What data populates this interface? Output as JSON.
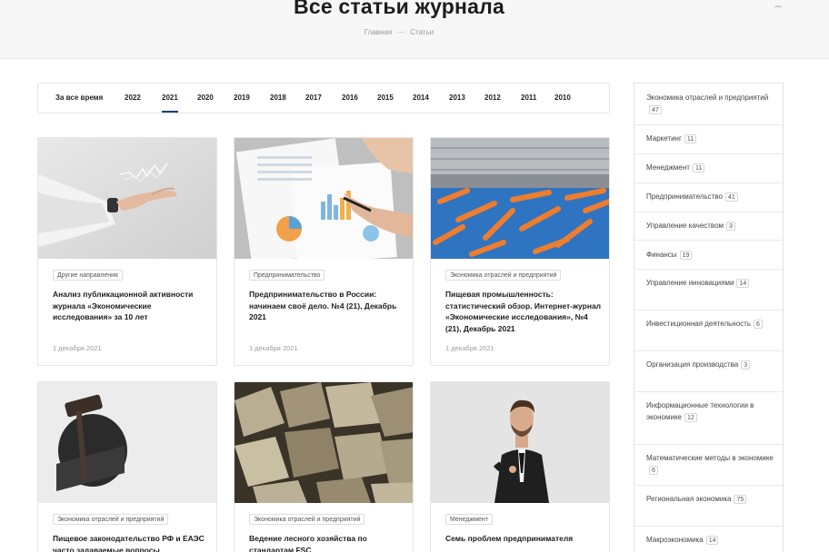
{
  "header": {
    "title": "Все статьи журнала",
    "breadcrumb": {
      "home": "Главная",
      "separator": "—",
      "current": "Статьи"
    }
  },
  "years": {
    "items": [
      "За все время",
      "2022",
      "2021",
      "2020",
      "2019",
      "2018",
      "2017",
      "2016",
      "2015",
      "2014",
      "2013",
      "2012",
      "2011",
      "2010"
    ],
    "active": "2021"
  },
  "articles": [
    {
      "tag": "Другие направления",
      "title": "Анализ публикационной активности журнала «Экономические исследования» за 10 лет",
      "date": "1 декабря 2021"
    },
    {
      "tag": "Предпринимательство",
      "title": "Предпринимательство в России: начинаем своё дело. №4 (21), Декабрь 2021",
      "date": "1 декабря 2021"
    },
    {
      "tag": "Экономика отраслей и предприятий",
      "title": "Пищевая промышленность: статистический обзор. Интернет-журнал «Экономические исследования», №4 (21), Декабрь 2021",
      "date": "1 декабря 2021"
    },
    {
      "tag": "Экономика отраслей и предприятий",
      "title": "Пищевое законодательство РФ и ЕАЭС часто задаваемые вопросы"
    },
    {
      "tag": "Экономика отраслей и предприятий",
      "title": "Ведение лесного хозяйства по стандартам FSC"
    },
    {
      "tag": "Менеджмент",
      "title": "Семь проблем предпринимателя"
    }
  ],
  "categories": [
    {
      "name": "Экономика отраслей и предприятий",
      "count": "47"
    },
    {
      "name": "Маркетинг",
      "count": "11"
    },
    {
      "name": "Менеджмент",
      "count": "11"
    },
    {
      "name": "Предпринимательство",
      "count": "41"
    },
    {
      "name": "Управление качеством",
      "count": "3"
    },
    {
      "name": "Финансы",
      "count": "19"
    },
    {
      "name": "Управление инновациями",
      "count": "14"
    },
    {
      "name": "Инвестиционная деятельность",
      "count": "6"
    },
    {
      "name": "Организация производства",
      "count": "3"
    },
    {
      "name": "Информационные технологии в экономике",
      "count": "12"
    },
    {
      "name": "Математические методы в экономике",
      "count": "6"
    },
    {
      "name": "Региональная экономика",
      "count": "75"
    },
    {
      "name": "Макроэкономика",
      "count": "14"
    }
  ],
  "icons": {
    "header": "rss-icon",
    "images": [
      "hand-chart-image",
      "documents-chart-image",
      "carrots-conveyor-image",
      "gavel-image",
      "firewood-image",
      "businessman-image"
    ]
  },
  "colors": {
    "accent": "#1f3b86",
    "border": "#e3e3e3",
    "header_bg": "#f7f7f7"
  }
}
